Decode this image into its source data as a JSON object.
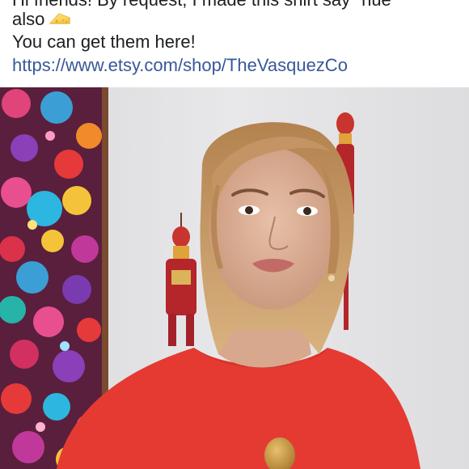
{
  "post": {
    "text_line_1": "Hi friends! By request, I made this shirt say \"nue\"",
    "text_line_2": "also",
    "emoji": "cheese-icon",
    "text_line_3": "You can get them here!",
    "link": "https://www.etsy.com/shop/TheVasquezCo"
  },
  "photo": {
    "subject": "woman-in-red-tshirt-with-gold-pendant",
    "palette": {
      "wall": "#e4e4e6",
      "shirt": "#e53a32",
      "hair": "#c99a63",
      "skin": "#ddb39b",
      "tapestry_base": "#5a1f3c"
    }
  },
  "colors": {
    "text": "#1c1e21",
    "link": "#385898",
    "background": "#ffffff"
  }
}
